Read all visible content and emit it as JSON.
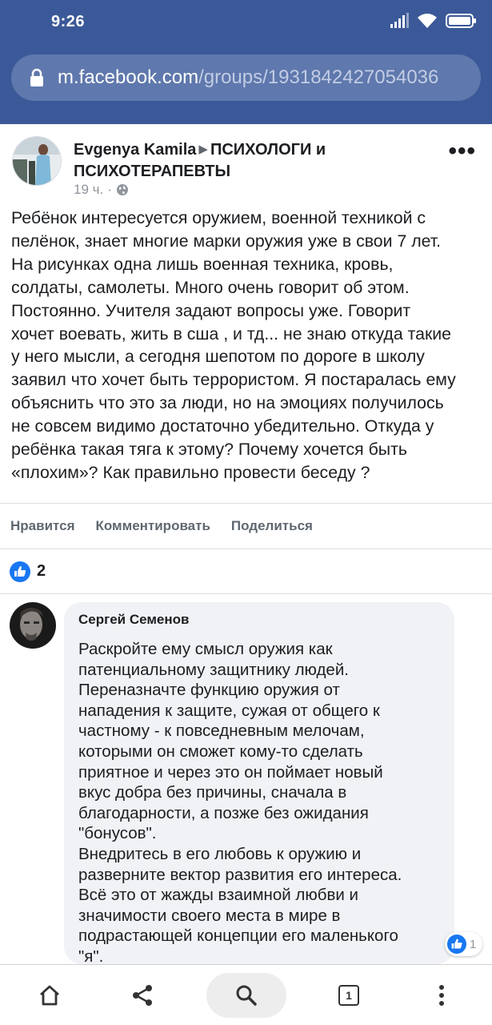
{
  "status_bar": {
    "time": "9:26"
  },
  "browser": {
    "url_domain": "m.facebook.com",
    "url_path": "/groups/1931842427054036"
  },
  "post": {
    "author": "Evgenya Kamila",
    "group": "ПСИХОЛОГИ и ПСИХОТЕРАПЕВТЫ",
    "time": "19 ч.",
    "separator": "·",
    "more_icon": "more-dots-icon",
    "text": "Ребёнок интересуется оружием, военной техникой с\nпелёнок, знает многие марки оружия уже в свои 7 лет.\nНа рисунках одна лишь военная техника, кровь,\nсолдаты, самолеты. Много очень говорит об этом.\nПостоянно. Учителя задают вопросы уже. Говорит\nхочет воевать, жить в сша , и тд... не знаю откуда такие\nу него мысли, а сегодня шепотом по дороге в школу\nзаявил что хочет быть террористом. Я постаралась ему\nобъяснить что это за люди, но на эмоциях получилось\nне совсем видимо достаточно убедительно. Откуда у\nребёнка такая тяга к этому? Почему хочется быть\n«плохим»? Как правильно провести беседу ?",
    "actions": {
      "like": "Нравится",
      "comment": "Комментировать",
      "share": "Поделиться"
    },
    "reaction_count": "2"
  },
  "comment": {
    "author": "Сергей Семенов",
    "text": "Раскройте ему смысл оружия как\nпатенциальному защитнику людей.\nПереназначте функцию оружия от\nнападения к защите, сужая от общего к\nчастному - к повседневным мелочам,\nкоторыми он сможет кому-то сделать\nприятное и через это он поймает новый\nвкус добра без причины, сначала в\nблагодарности, а позже без ожидания\n\"бонусов\".\nВнедритесь в его любовь к оружию и\nразверните вектор развития его интереса.\nВсё это от жажды взаимной любви и\nзначимости своего места в мире в\nподрастающей концепции его маленького\n\"я\".",
    "like_count": "1"
  },
  "bottom_nav": {
    "tab_count": "1"
  },
  "colors": {
    "facebook_blue": "#3b5998",
    "like_blue": "#1877f2",
    "text_primary": "#1c1e21",
    "text_secondary": "#606770"
  }
}
